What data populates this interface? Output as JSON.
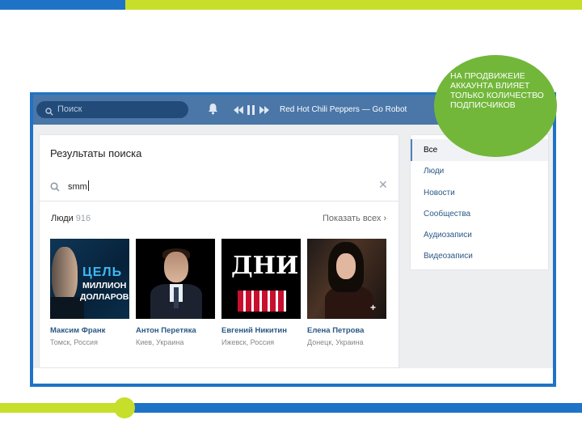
{
  "header": {
    "search_placeholder": "Поиск",
    "track": "Red Hot Chili Peppers — Go Robot"
  },
  "results": {
    "title": "Результаты поиска",
    "query": "smm",
    "people_label": "Люди",
    "people_count": "916",
    "show_all": "Показать всех",
    "people": [
      {
        "name": "Максим Франк",
        "location": "Томск, Россия",
        "photo_text": [
          "ЦЕЛЬ",
          "МИЛЛИОН",
          "ДОЛЛАРОВ"
        ]
      },
      {
        "name": "Антон Перетяка",
        "location": "Киев, Украина"
      },
      {
        "name": "Евгений Никитин",
        "location": "Ижевск, Россия",
        "photo_text": [
          "ДНИ"
        ]
      },
      {
        "name": "Елена Петрова",
        "location": "Донецк, Украина"
      }
    ]
  },
  "filters": [
    "Все",
    "Люди",
    "Новости",
    "Сообщества",
    "Аудиозаписи",
    "Видеозаписи"
  ],
  "callout": "НА ПРОДВИЖЕИЕ АККАУНТА ВЛИЯЕТ ТОЛЬКО КОЛИЧЕСТВО ПОДПИСЧИКОВ",
  "colors": {
    "brand_blue": "#1f73c6",
    "accent_green": "#c7de2a",
    "callout_green": "#72b73a",
    "vk_header": "#4a76a8"
  }
}
